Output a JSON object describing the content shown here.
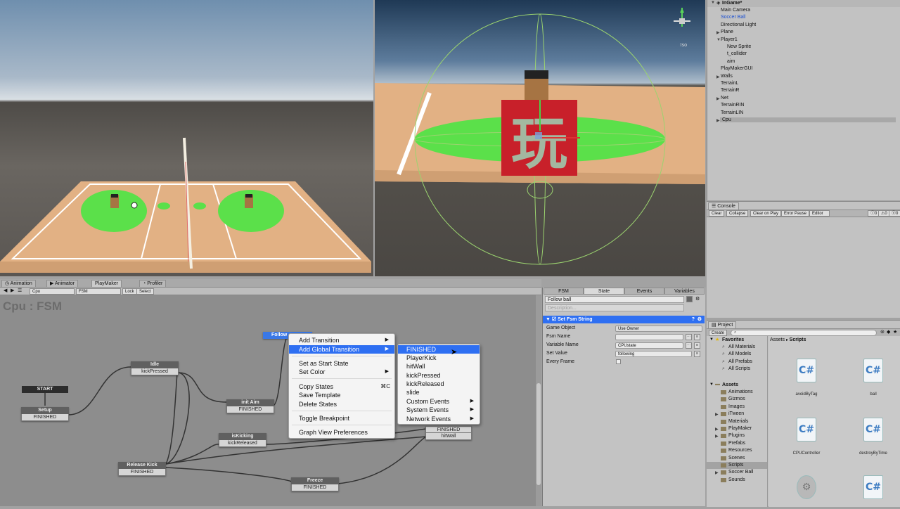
{
  "hierarchy": {
    "scene_name": "InGame*",
    "items": [
      {
        "label": "Main Camera",
        "indent": 1,
        "arrow": false,
        "selected": false
      },
      {
        "label": "Soccer Ball",
        "indent": 1,
        "arrow": false,
        "selected": true
      },
      {
        "label": "Directional Light",
        "indent": 1,
        "arrow": false,
        "selected": false
      },
      {
        "label": "Plane",
        "indent": 1,
        "arrow": true,
        "selected": false
      },
      {
        "label": "Player1",
        "indent": 1,
        "arrow": true,
        "selected": false
      },
      {
        "label": "New Sprite",
        "indent": 2,
        "arrow": false,
        "selected": false
      },
      {
        "label": "t_collider",
        "indent": 2,
        "arrow": false,
        "selected": false
      },
      {
        "label": "aim",
        "indent": 2,
        "arrow": false,
        "selected": false
      },
      {
        "label": "PlayMakerGUI",
        "indent": 1,
        "arrow": false,
        "selected": false
      },
      {
        "label": "Walls",
        "indent": 1,
        "arrow": true,
        "selected": false
      },
      {
        "label": "TerrainL",
        "indent": 1,
        "arrow": false,
        "selected": false
      },
      {
        "label": "TerrainR",
        "indent": 1,
        "arrow": false,
        "selected": false
      },
      {
        "label": "Net",
        "indent": 1,
        "arrow": true,
        "selected": false
      },
      {
        "label": "TerrainRIN",
        "indent": 1,
        "arrow": false,
        "selected": false
      },
      {
        "label": "TerrainLIN",
        "indent": 1,
        "arrow": false,
        "selected": false
      },
      {
        "label": "Cpu",
        "indent": 1,
        "arrow": true,
        "selected": false
      }
    ]
  },
  "scene": {
    "projection_label": "Iso"
  },
  "console": {
    "tab": "Console",
    "buttons": [
      "Clear",
      "Collapse",
      "Clear on Play",
      "Error Pause",
      "Editor"
    ],
    "counts": [
      "0",
      "0",
      "0"
    ]
  },
  "bottom_tabs": [
    "Animation",
    "Animator",
    "PlayMaker",
    "Profiler"
  ],
  "fsm_toolbar": {
    "object": "Cpu",
    "fsm": "FSM",
    "lock": "Lock",
    "select": "Select"
  },
  "graph": {
    "title": "Cpu : FSM",
    "start_label": "START",
    "nodes": [
      {
        "name": "Setup",
        "event": "FINISHED"
      },
      {
        "name": "Idle",
        "event": "kickPressed"
      },
      {
        "name": "init Aim",
        "event": "FINISHED"
      },
      {
        "name": "isKicking",
        "event": "kickReleased"
      },
      {
        "name": "Release Kick",
        "event": "FINISHED"
      },
      {
        "name": "Freeze",
        "event": "FINISHED"
      },
      {
        "name": "Follow ball",
        "event": ""
      }
    ],
    "follow_extra_events": [
      "FINISHED",
      "hitWall"
    ],
    "selected_node_label": "Follow"
  },
  "context_menu": {
    "items": [
      {
        "label": "Add Transition",
        "submenu": true,
        "shortcut": ""
      },
      {
        "label": "Add Global Transition",
        "submenu": true,
        "shortcut": "",
        "highlight": true
      },
      {
        "label": "Set as Start State",
        "submenu": false,
        "shortcut": ""
      },
      {
        "label": "Set Color",
        "submenu": true,
        "shortcut": ""
      },
      {
        "label": "Copy States",
        "submenu": false,
        "shortcut": "⌘C"
      },
      {
        "label": "Save Template",
        "submenu": false,
        "shortcut": ""
      },
      {
        "label": "Delete States",
        "submenu": false,
        "shortcut": ""
      },
      {
        "label": "Toggle Breakpoint",
        "submenu": false,
        "shortcut": ""
      },
      {
        "label": "Graph View Preferences",
        "submenu": false,
        "shortcut": ""
      }
    ]
  },
  "submenu": {
    "items": [
      {
        "label": "FINISHED",
        "submenu": false,
        "highlight": true
      },
      {
        "label": "PlayerKick",
        "submenu": false
      },
      {
        "label": "hitWall",
        "submenu": false
      },
      {
        "label": "kickPressed",
        "submenu": false
      },
      {
        "label": "kickReleased",
        "submenu": false
      },
      {
        "label": "slide",
        "submenu": false
      },
      {
        "label": "Custom Events",
        "submenu": true
      },
      {
        "label": "System Events",
        "submenu": true
      },
      {
        "label": "Network Events",
        "submenu": true
      }
    ]
  },
  "inspector": {
    "tabs": [
      "FSM",
      "State",
      "Events",
      "Variables"
    ],
    "active_tab": "State",
    "state_name": "Follow ball",
    "description_placeholder": "Description...",
    "action_title": "Set Fsm String",
    "fields": [
      {
        "label": "Game Object",
        "value": "Use Owner"
      },
      {
        "label": "Fsm Name",
        "value": ""
      },
      {
        "label": "Variable Name",
        "value": "CPUstate"
      },
      {
        "label": "Set Value",
        "value": "following"
      },
      {
        "label": "Every Frame",
        "value": ""
      }
    ]
  },
  "project": {
    "tab": "Project",
    "create_label": "Create",
    "breadcrumb": [
      "Assets",
      "Scripts"
    ],
    "favorites_label": "Favorites",
    "favorites": [
      "All Materials",
      "All Models",
      "All Prefabs",
      "All Scripts"
    ],
    "assets_label": "Assets",
    "folders": [
      {
        "label": "Animations",
        "arrow": false
      },
      {
        "label": "Gizmos",
        "arrow": false
      },
      {
        "label": "Images",
        "arrow": false
      },
      {
        "label": "iTween",
        "arrow": true
      },
      {
        "label": "Materials",
        "arrow": false
      },
      {
        "label": "PlayMaker",
        "arrow": true
      },
      {
        "label": "Plugins",
        "arrow": true
      },
      {
        "label": "Prefabs",
        "arrow": false
      },
      {
        "label": "Resources",
        "arrow": false
      },
      {
        "label": "Scenes",
        "arrow": false
      },
      {
        "label": "Scripts",
        "arrow": false,
        "selected": true
      },
      {
        "label": "Soccer Ball",
        "arrow": true
      },
      {
        "label": "Sounds",
        "arrow": false
      }
    ],
    "files": [
      "avoidByTag",
      "ball",
      "CPUController",
      "destroyByTime",
      "",
      ""
    ]
  },
  "colors": {
    "accent": "#2e6ff2",
    "court": "#e8b98a",
    "green_zone": "#5be04a",
    "sign_red": "#c8202a"
  }
}
